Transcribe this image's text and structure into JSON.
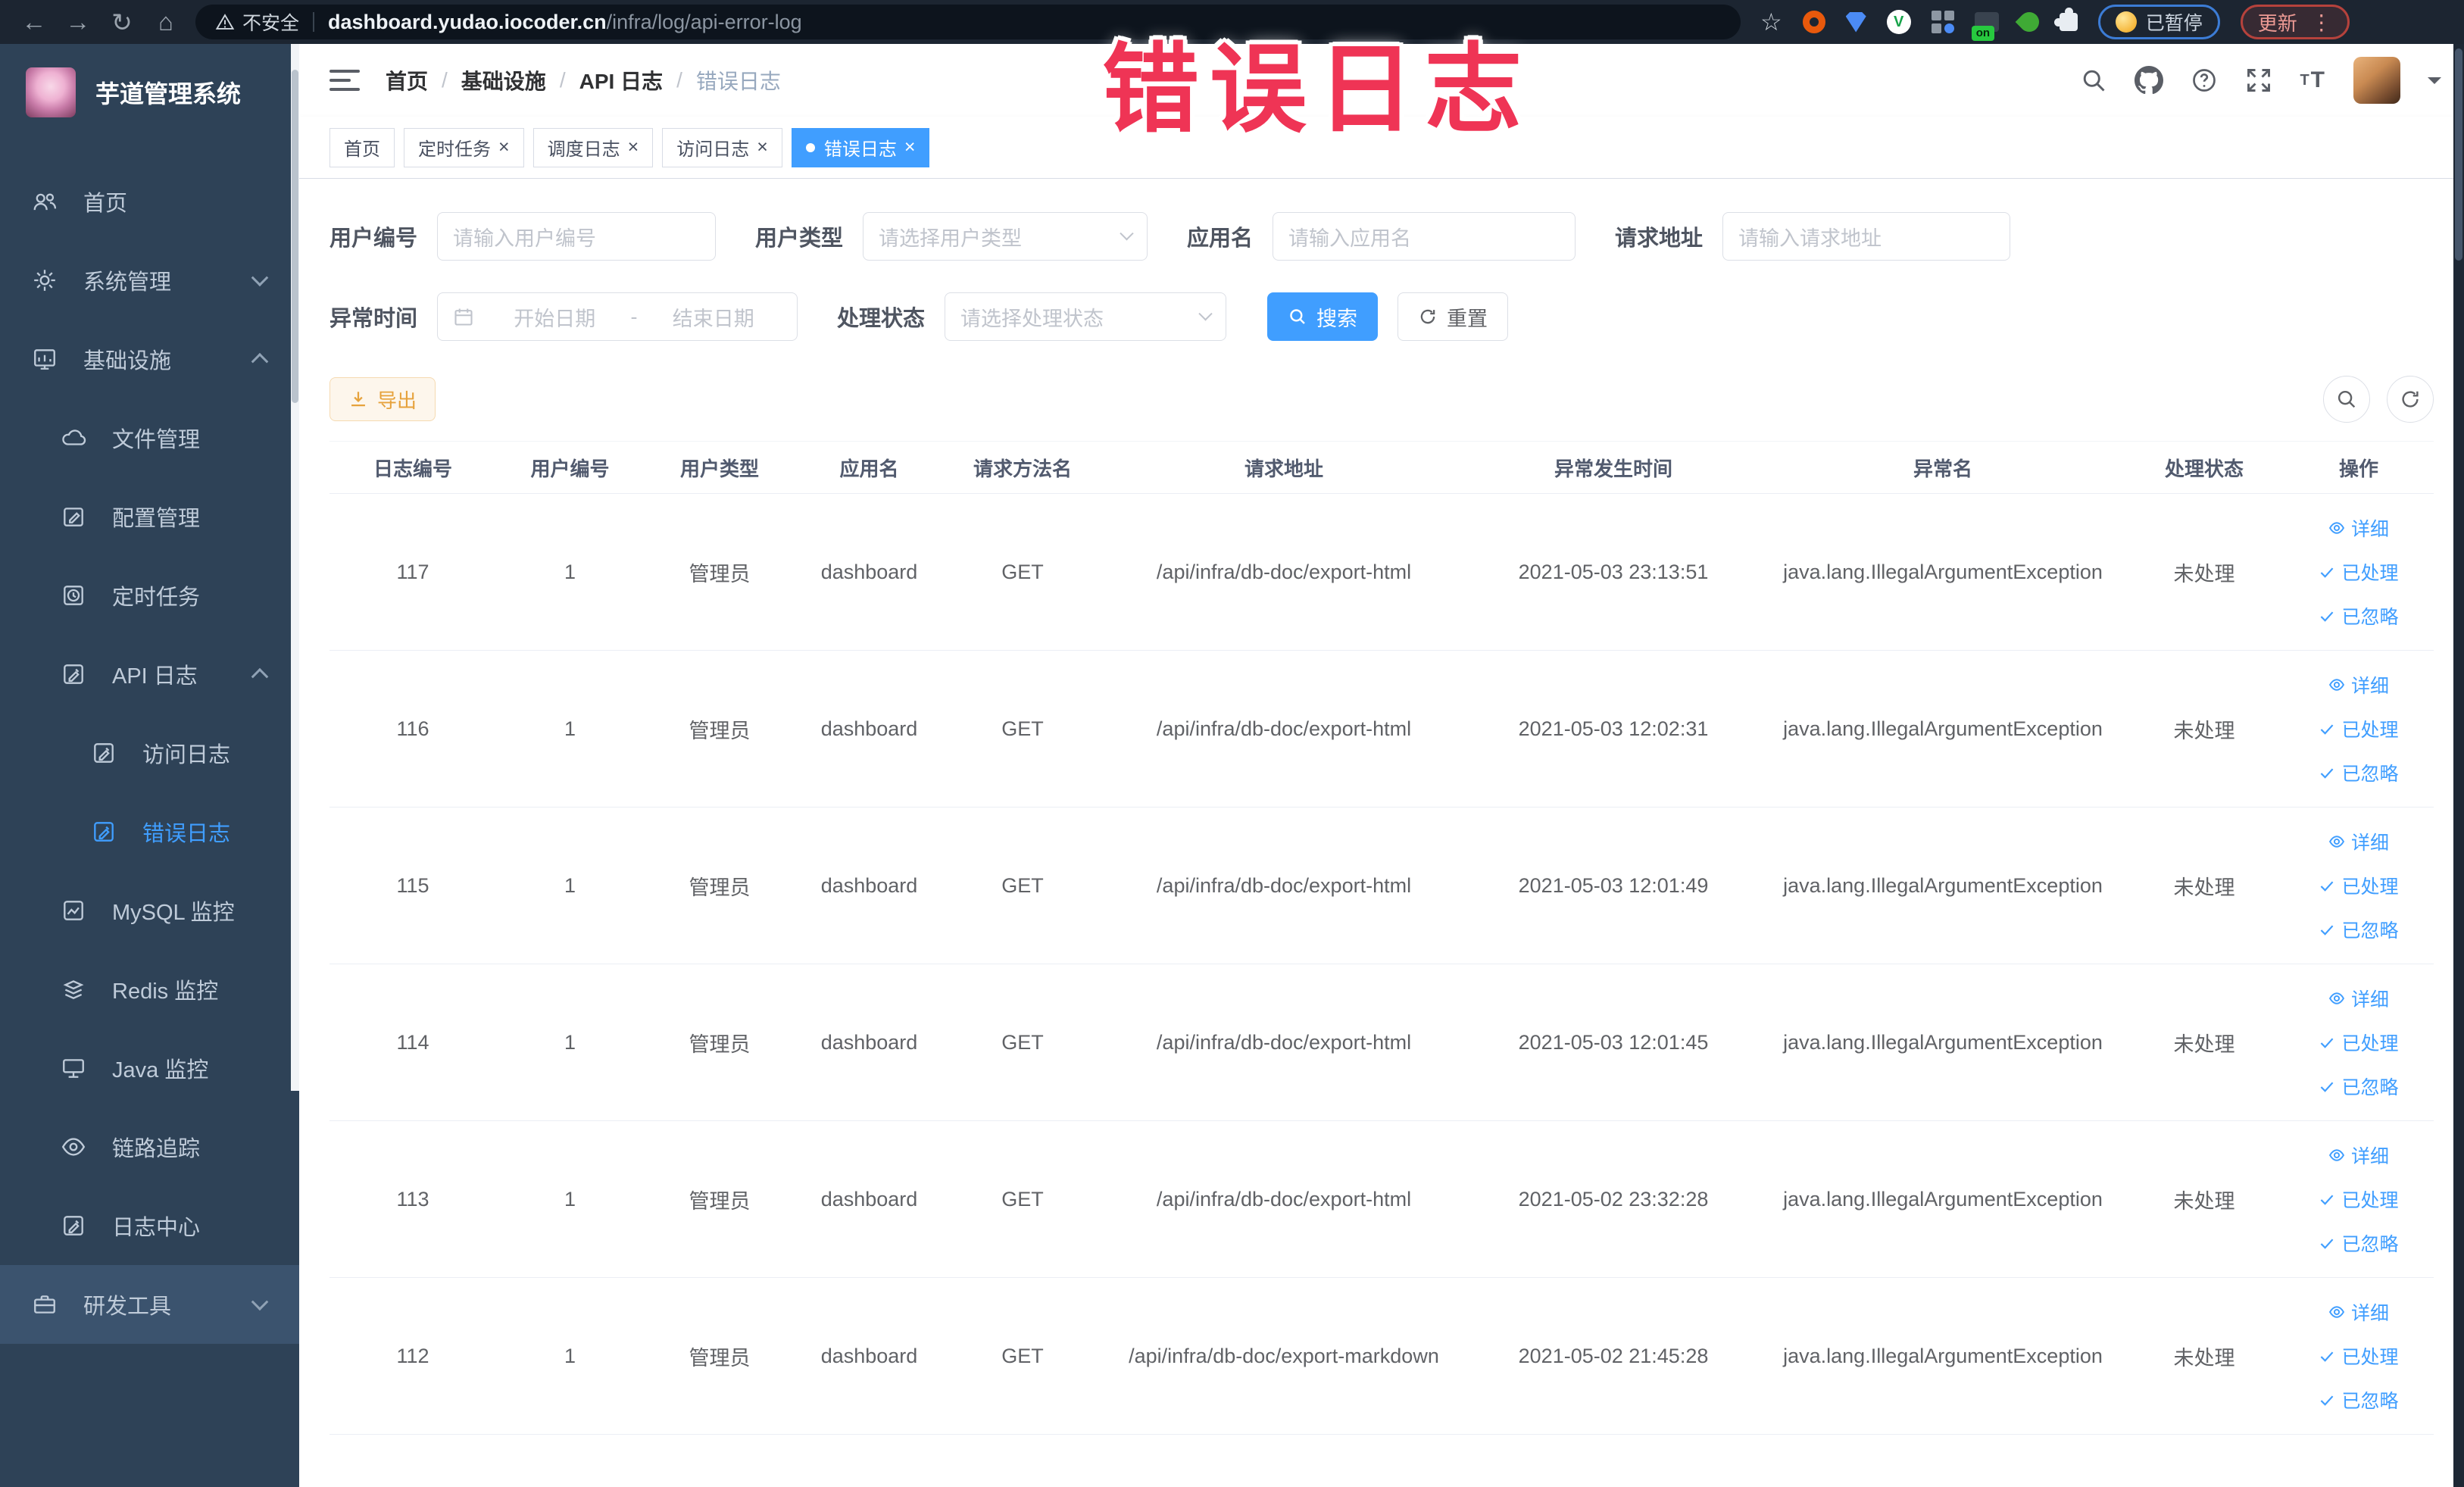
{
  "annotation": {
    "text": "错误日志",
    "color": "#ef3455"
  },
  "browser": {
    "security_label": "不安全",
    "url_domain": "dashboard.yudao.iocoder.cn",
    "url_path": "/infra/log/api-error-log",
    "on_badge": "on",
    "paused_badge": "已暂停",
    "update_button": "更新"
  },
  "sidebar": {
    "title": "芋道管理系统",
    "items": [
      {
        "label": "首页",
        "icon": "users",
        "level": 0
      },
      {
        "label": "系统管理",
        "icon": "gear",
        "level": 0,
        "arrow": "down"
      },
      {
        "label": "基础设施",
        "icon": "infra",
        "level": 0,
        "arrow": "up"
      },
      {
        "label": "文件管理",
        "icon": "file",
        "level": 1
      },
      {
        "label": "配置管理",
        "icon": "config",
        "level": 1
      },
      {
        "label": "定时任务",
        "icon": "job",
        "level": 1
      },
      {
        "label": "API 日志",
        "icon": "log",
        "level": 1,
        "arrow": "up"
      },
      {
        "label": "访问日志",
        "icon": "log",
        "level": 2
      },
      {
        "label": "错误日志",
        "icon": "log",
        "level": 2,
        "active": true
      },
      {
        "label": "MySQL 监控",
        "icon": "mysql",
        "level": 1
      },
      {
        "label": "Redis 监控",
        "icon": "redis",
        "level": 1
      },
      {
        "label": "Java 监控",
        "icon": "java",
        "level": 1
      },
      {
        "label": "链路追踪",
        "icon": "trace",
        "level": 1
      },
      {
        "label": "日志中心",
        "icon": "log",
        "level": 1
      },
      {
        "label": "研发工具",
        "icon": "tools",
        "level": 0,
        "arrow": "down",
        "hovered": true
      }
    ]
  },
  "header": {
    "breadcrumb": [
      "首页",
      "基础设施",
      "API 日志",
      "错误日志"
    ]
  },
  "tabs": [
    {
      "label": "首页",
      "closable": false,
      "active": false
    },
    {
      "label": "定时任务",
      "closable": true,
      "active": false
    },
    {
      "label": "调度日志",
      "closable": true,
      "active": false
    },
    {
      "label": "访问日志",
      "closable": true,
      "active": false
    },
    {
      "label": "错误日志",
      "closable": true,
      "active": true
    }
  ],
  "filters": {
    "user_id": {
      "label": "用户编号",
      "placeholder": "请输入用户编号"
    },
    "user_type": {
      "label": "用户类型",
      "placeholder": "请选择用户类型"
    },
    "app_name": {
      "label": "应用名",
      "placeholder": "请输入应用名"
    },
    "request_url": {
      "label": "请求地址",
      "placeholder": "请输入请求地址"
    },
    "exception_time": {
      "label": "异常时间",
      "start_placeholder": "开始日期",
      "separator": "-",
      "end_placeholder": "结束日期"
    },
    "process_status": {
      "label": "处理状态",
      "placeholder": "请选择处理状态"
    },
    "search_button": "搜索",
    "reset_button": "重置"
  },
  "toolbar": {
    "export_button": "导出"
  },
  "table": {
    "columns": [
      "日志编号",
      "用户编号",
      "用户类型",
      "应用名",
      "请求方法名",
      "请求地址",
      "异常发生时间",
      "异常名",
      "处理状态",
      "操作"
    ],
    "actions": [
      {
        "label": "详细",
        "icon": "view"
      },
      {
        "label": "已处理",
        "icon": "check"
      },
      {
        "label": "已忽略",
        "icon": "check"
      }
    ],
    "rows": [
      {
        "id": "117",
        "user_id": "1",
        "user_type": "管理员",
        "app": "dashboard",
        "method": "GET",
        "url": "/api/infra/db-doc/export-html",
        "time": "2021-05-03 23:13:51",
        "exception": "java.lang.IllegalArgumentException",
        "status": "未处理"
      },
      {
        "id": "116",
        "user_id": "1",
        "user_type": "管理员",
        "app": "dashboard",
        "method": "GET",
        "url": "/api/infra/db-doc/export-html",
        "time": "2021-05-03 12:02:31",
        "exception": "java.lang.IllegalArgumentException",
        "status": "未处理"
      },
      {
        "id": "115",
        "user_id": "1",
        "user_type": "管理员",
        "app": "dashboard",
        "method": "GET",
        "url": "/api/infra/db-doc/export-html",
        "time": "2021-05-03 12:01:49",
        "exception": "java.lang.IllegalArgumentException",
        "status": "未处理"
      },
      {
        "id": "114",
        "user_id": "1",
        "user_type": "管理员",
        "app": "dashboard",
        "method": "GET",
        "url": "/api/infra/db-doc/export-html",
        "time": "2021-05-03 12:01:45",
        "exception": "java.lang.IllegalArgumentException",
        "status": "未处理"
      },
      {
        "id": "113",
        "user_id": "1",
        "user_type": "管理员",
        "app": "dashboard",
        "method": "GET",
        "url": "/api/infra/db-doc/export-html",
        "time": "2021-05-02 23:32:28",
        "exception": "java.lang.IllegalArgumentException",
        "status": "未处理"
      },
      {
        "id": "112",
        "user_id": "1",
        "user_type": "管理员",
        "app": "dashboard",
        "method": "GET",
        "url": "/api/infra/db-doc/export-markdown",
        "time": "2021-05-02 21:45:28",
        "exception": "java.lang.IllegalArgumentException",
        "status": "未处理"
      }
    ]
  },
  "colors": {
    "accent": "#409eff",
    "sidebar_bg": "#2e4257",
    "chrome_bg": "#1c2531",
    "warning_button": "#e6a23c",
    "annotation_red": "#ef3455"
  }
}
